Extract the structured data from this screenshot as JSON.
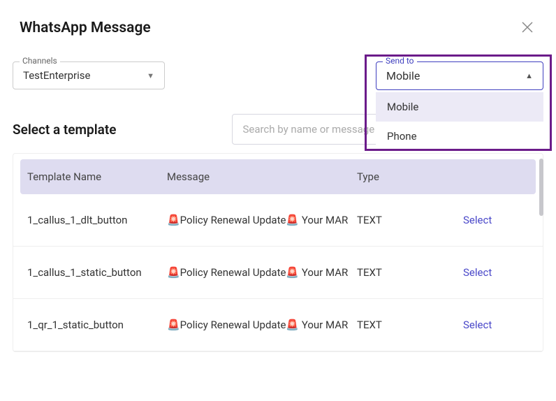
{
  "header": {
    "title": "WhatsApp Message"
  },
  "channels": {
    "label": "Channels",
    "value": "TestEnterprise"
  },
  "sendto": {
    "label": "Send to",
    "value": "Mobile",
    "options": [
      "Mobile",
      "Phone"
    ]
  },
  "template_section": {
    "title": "Select a template",
    "search_placeholder": "Search by name or message"
  },
  "table": {
    "headers": {
      "name": "Template Name",
      "message": "Message",
      "type": "Type"
    },
    "select_label": "Select",
    "rows": [
      {
        "name": "1_callus_1_dlt_button",
        "message": "🚨Policy Renewal Update🚨 Your MAR",
        "type": "TEXT"
      },
      {
        "name": "1_callus_1_static_button",
        "message": "🚨Policy Renewal Update🚨 Your MAR",
        "type": "TEXT"
      },
      {
        "name": "1_qr_1_static_button",
        "message": "🚨Policy Renewal Update🚨 Your MAR",
        "type": "TEXT"
      }
    ]
  }
}
